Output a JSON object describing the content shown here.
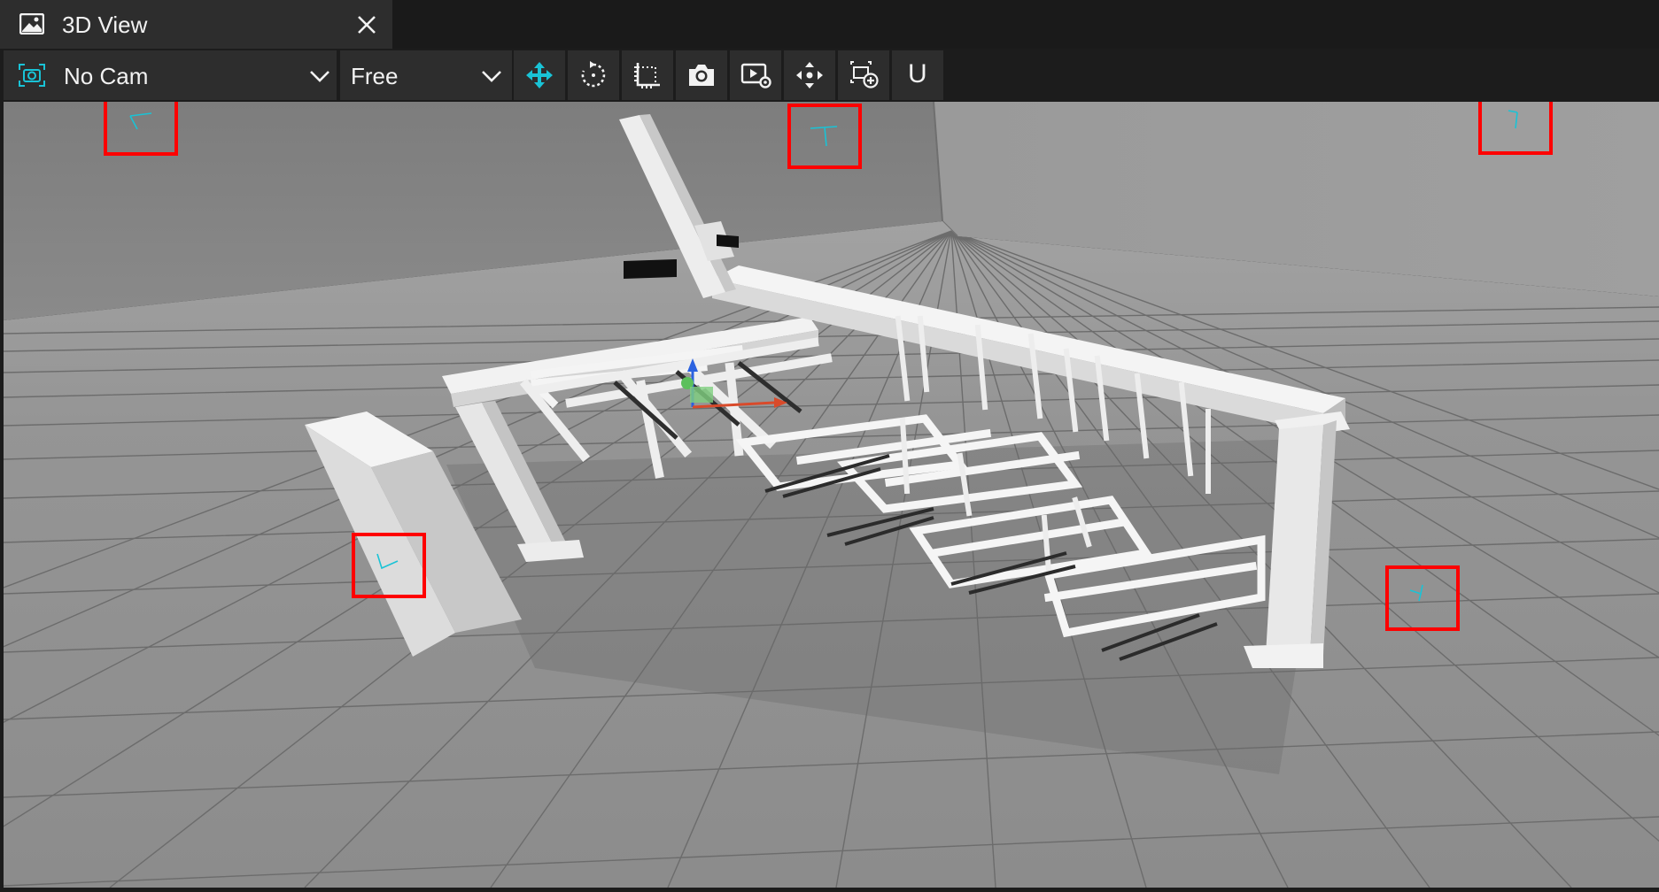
{
  "window": {
    "tab_title": "3D View"
  },
  "toolbar": {
    "camera_select": "No Cam",
    "view_mode_select": "Free",
    "buttons": [
      {
        "icon": "move-gizmo-icon",
        "active": true
      },
      {
        "icon": "rotate-icon"
      },
      {
        "icon": "scale-icon"
      },
      {
        "icon": "camera-snapshot-icon"
      },
      {
        "icon": "render-settings-icon"
      },
      {
        "icon": "pan-icon"
      },
      {
        "icon": "add-camera-icon"
      }
    ],
    "u_label": "U"
  },
  "viewport": {
    "markers": [
      {
        "name": "marker-top-left-gizmo"
      },
      {
        "name": "marker-top-center-gizmo"
      },
      {
        "name": "marker-top-right-gizmo"
      },
      {
        "name": "marker-left-pillar-gizmo"
      },
      {
        "name": "marker-right-gizmo"
      }
    ]
  },
  "colors": {
    "accent": "#19c3d6",
    "marker": "#ff0000",
    "toolbar_bg": "#2d2d2d",
    "viewport_floor": "#8f8f8f"
  }
}
